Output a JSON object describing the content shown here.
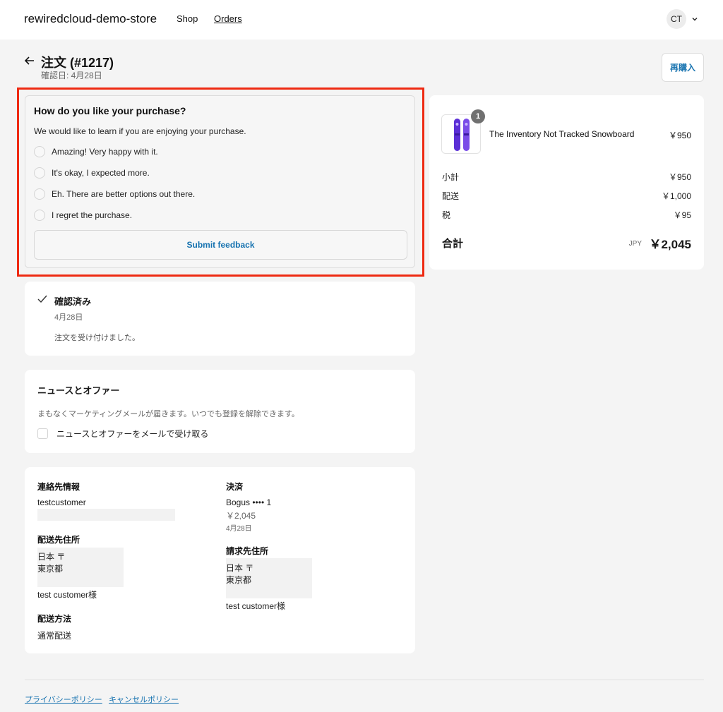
{
  "header": {
    "store_name": "rewiredcloud-demo-store",
    "nav": {
      "shop": "Shop",
      "orders": "Orders"
    },
    "avatar_initials": "CT"
  },
  "order": {
    "title": "注文 (#1217)",
    "confirmed": "確認日: 4月28日",
    "rebuy_label": "再購入"
  },
  "survey": {
    "title": "How do you like your purchase?",
    "description": "We would like to learn if you are enjoying your purchase.",
    "options": [
      "Amazing! Very happy with it.",
      "It's okay, I expected more.",
      "Eh. There are better options out there.",
      "I regret the purchase."
    ],
    "submit_label": "Submit feedback"
  },
  "status": {
    "title": "確認済み",
    "date": "4月28日",
    "message": "注文を受け付けました。"
  },
  "news": {
    "title": "ニュースとオファー",
    "description": "まもなくマーケティングメールが届きます。いつでも登録を解除できます。",
    "checkbox_label": "ニュースとオファーをメールで受け取る"
  },
  "info": {
    "contact": {
      "label": "連絡先情報",
      "name": "testcustomer"
    },
    "shipping_address": {
      "label": "配送先住所",
      "line1": "日本 〒",
      "line2": "東京都",
      "recipient": "test customer様"
    },
    "shipping_method": {
      "label": "配送方法",
      "value": "通常配送"
    },
    "payment": {
      "label": "決済",
      "method": "Bogus •••• 1",
      "amount": "￥2,045",
      "date": "4月28日"
    },
    "billing_address": {
      "label": "請求先住所",
      "line1": "日本 〒",
      "line2": "東京都",
      "recipient": "test customer様"
    }
  },
  "summary": {
    "product": {
      "name": "The Inventory Not Tracked Snowboard",
      "price": "￥950",
      "quantity": "1"
    },
    "subtotal": {
      "label": "小計",
      "value": "￥950"
    },
    "shipping": {
      "label": "配送",
      "value": "￥1,000"
    },
    "tax": {
      "label": "税",
      "value": "￥95"
    },
    "total": {
      "label": "合計",
      "currency": "JPY",
      "value": "￥2,045"
    }
  },
  "footer": {
    "privacy": "プライバシーポリシー",
    "cancel": "キャンセルポリシー"
  },
  "colors": {
    "accent": "#1773b0",
    "highlight": "#ee2a12",
    "background": "#f4f4f4"
  }
}
